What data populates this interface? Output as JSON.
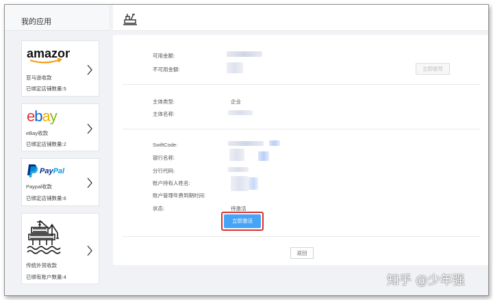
{
  "sidebar": {
    "title": "我的应用",
    "cards": [
      {
        "logo": "amazon",
        "name": "亚马逊收款",
        "count": "已绑定店铺数量:5"
      },
      {
        "logo": "ebay",
        "name": "eBay收款",
        "count": "已绑定店铺数量:2"
      },
      {
        "logo": "PayPal",
        "name": "Paypal收款",
        "count": "已绑定店铺数量:6"
      },
      {
        "logo": "oil-platform-icon",
        "name": "传统外贸收款",
        "count": "已绑有账户数量:4"
      }
    ]
  },
  "header": {
    "icon": "system-icon"
  },
  "balance": {
    "available_label": "可用金额:",
    "unavailable_label": "不可用金额:",
    "withdraw_button": "立即提现"
  },
  "entity": {
    "type_label": "主体类型:",
    "type_value": "企业",
    "name_label": "主体名称:"
  },
  "bank": {
    "swift_label": "SwiftCode:",
    "bank_name_label": "银行名称:",
    "branch_code_label": "分行代码:",
    "holder_label": "账户持有人姓名:",
    "fee_expiry_label": "账户管理年费到期时间:",
    "status_label": "状态:",
    "status_value": "待激活",
    "activate_button": "立即激活"
  },
  "footer": {
    "back_button": "返回"
  },
  "watermark": "知乎 @少年强",
  "colors": {
    "accent": "#45a4f5",
    "highlight": "#d9302c"
  }
}
